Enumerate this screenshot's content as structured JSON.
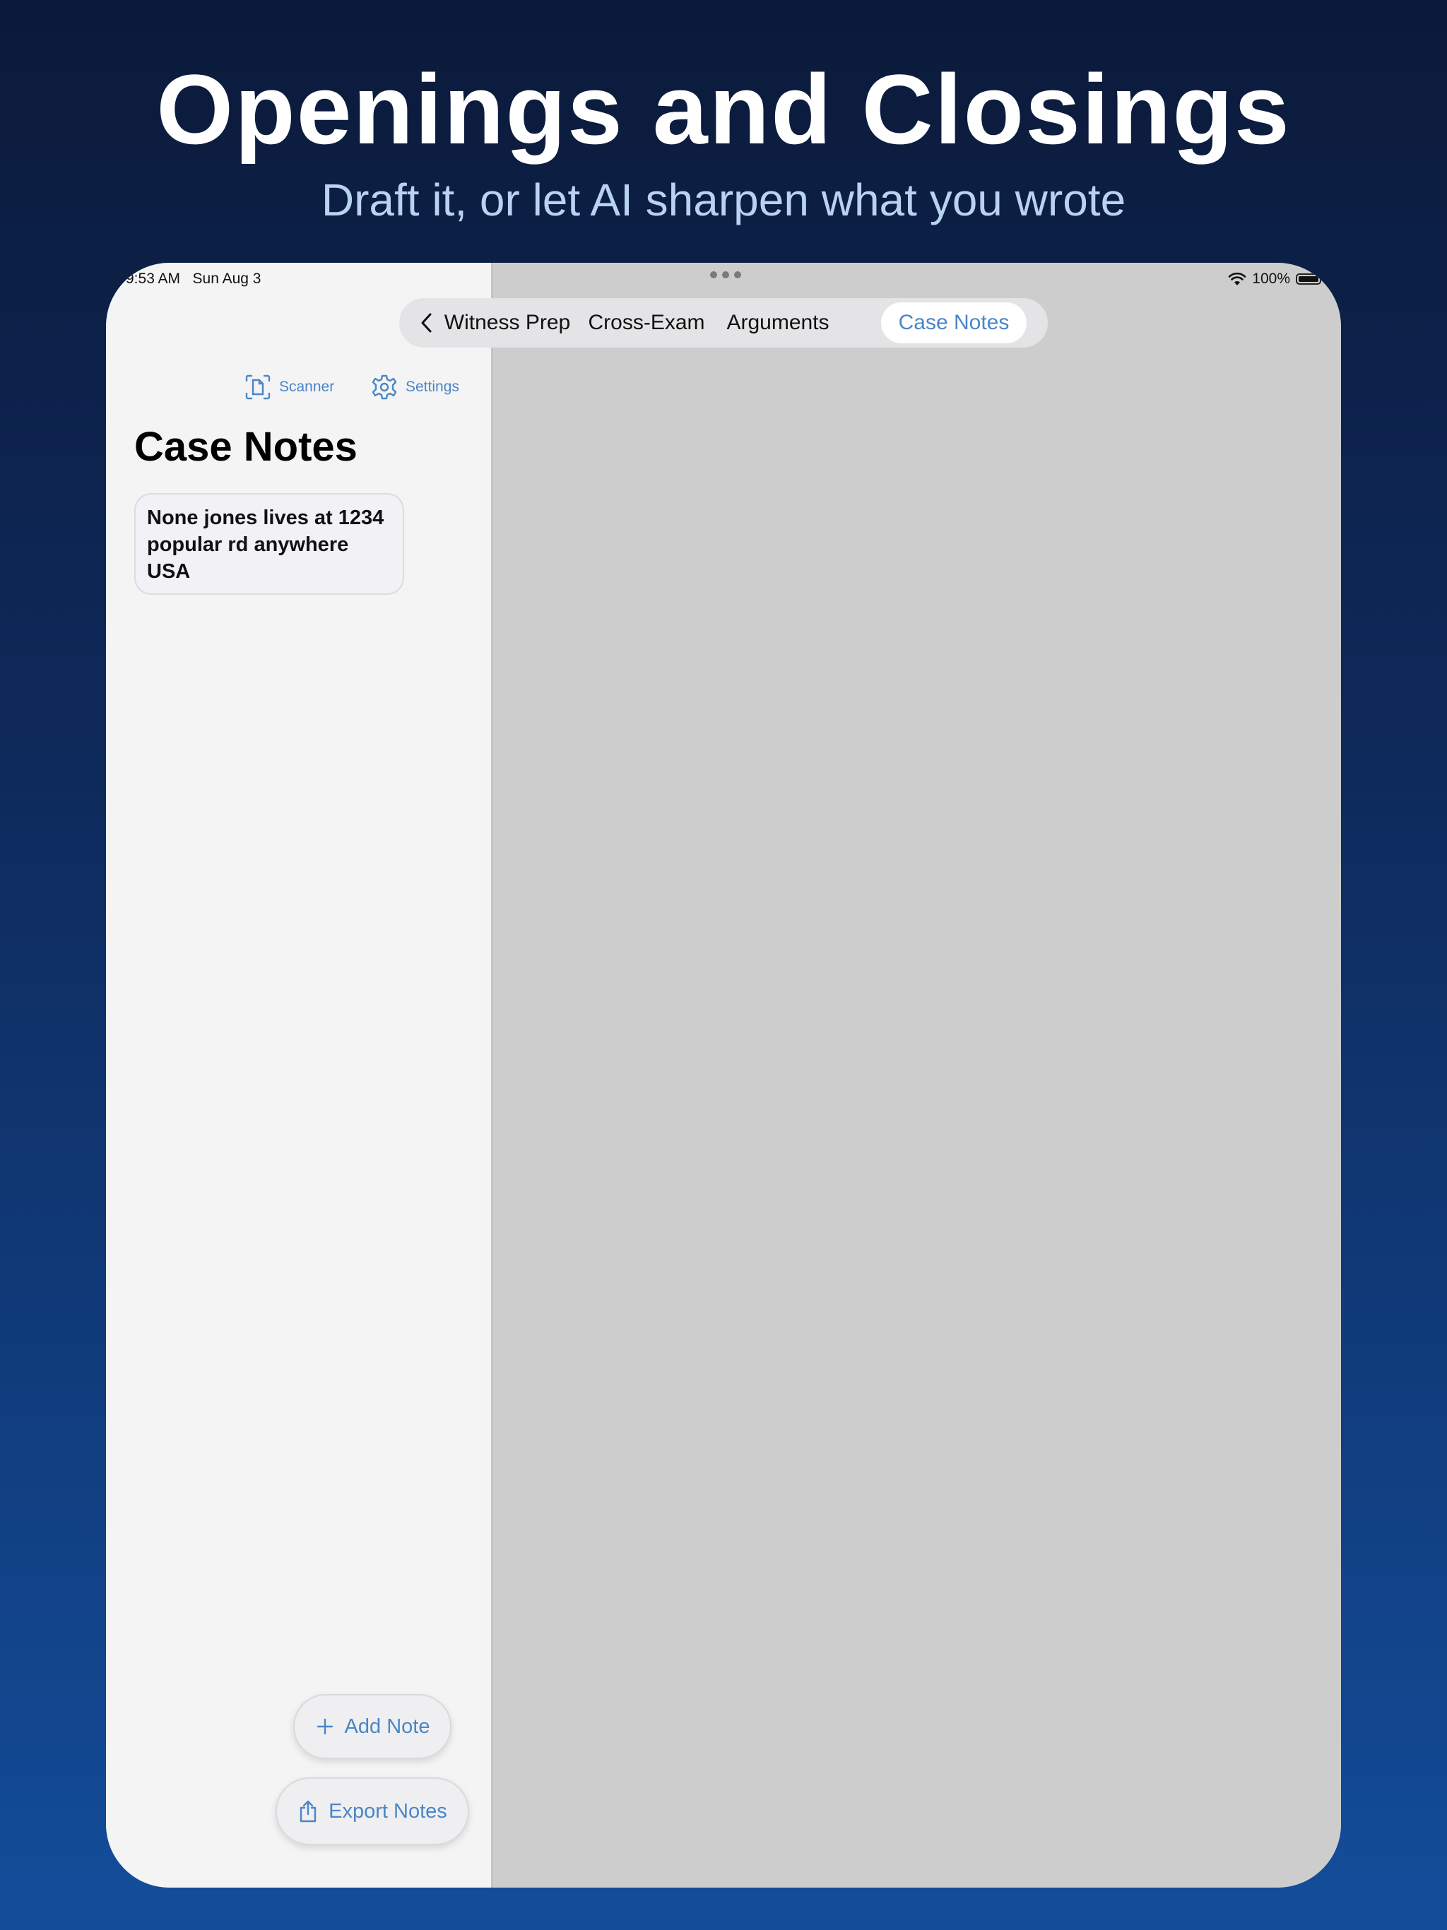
{
  "promo": {
    "headline": "Openings and Closings",
    "subhead": "Draft it, or let AI sharpen what you wrote"
  },
  "status_bar": {
    "time": "9:53 AM   Sun Aug 3",
    "battery": "100%",
    "battery_level": 1.0
  },
  "tabs": {
    "items": [
      {
        "label": "Witness Prep"
      },
      {
        "label": "Cross-Exam"
      },
      {
        "label": "Arguments"
      },
      {
        "label": "Case Notes"
      }
    ],
    "active": "Case Notes"
  },
  "toolbar": {
    "scanner_label": "Scanner",
    "settings_label": "Settings"
  },
  "sidebar": {
    "title": "Case Notes",
    "notes": [
      {
        "text": "None jones lives at 1234 popular rd anywhere USA"
      }
    ]
  },
  "actions": {
    "add_note": "Add Note",
    "export_notes": "Export Notes"
  },
  "colors": {
    "accent": "#4a86c8",
    "background_top": "#0b1a3a",
    "background_bottom": "#134d9a",
    "subhead": "#b9d2f0"
  },
  "icons": [
    "back-chevron-icon",
    "scanner-icon",
    "gear-icon",
    "plus-icon",
    "share-icon",
    "wifi-icon",
    "battery-icon"
  ]
}
